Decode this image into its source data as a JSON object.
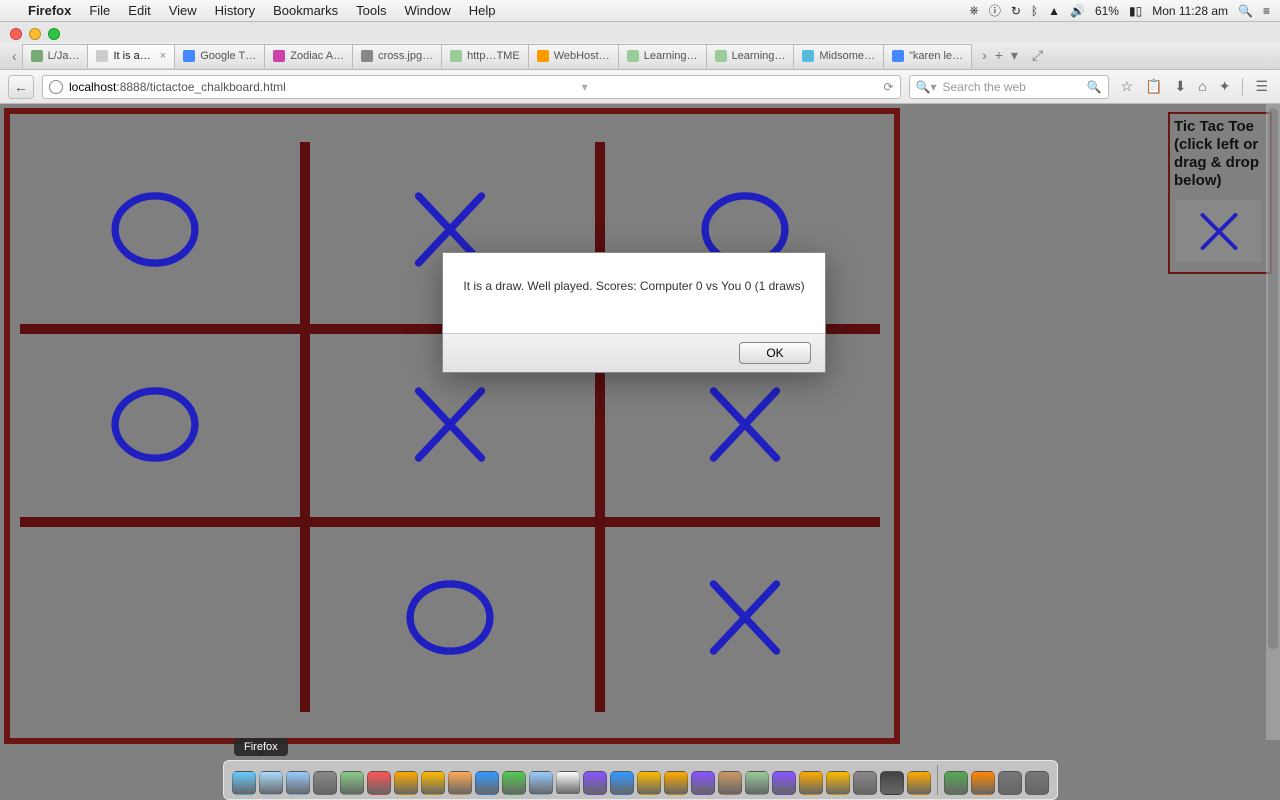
{
  "menubar": {
    "app": "Firefox",
    "items": [
      "File",
      "Edit",
      "View",
      "History",
      "Bookmarks",
      "Tools",
      "Window",
      "Help"
    ],
    "battery": "61%",
    "clock": "Mon 11:28 am"
  },
  "tabs": [
    {
      "label": "L/Ja…",
      "active": false
    },
    {
      "label": "It is a…",
      "active": true
    },
    {
      "label": "Google T…",
      "active": false
    },
    {
      "label": "Zodiac A…",
      "active": false
    },
    {
      "label": "cross.jpg…",
      "active": false
    },
    {
      "label": "http…TME",
      "active": false
    },
    {
      "label": "WebHost…",
      "active": false
    },
    {
      "label": "Learning…",
      "active": false
    },
    {
      "label": "Learning…",
      "active": false
    },
    {
      "label": "Midsome…",
      "active": false
    },
    {
      "label": "\"karen le…",
      "active": false
    }
  ],
  "url": {
    "host": "localhost",
    "port": ":8888",
    "path": "/tictactoe_chalkboard.html"
  },
  "search_placeholder": "Search the web",
  "sidebar": {
    "title": "Tic Tac Toe (click left or drag & drop below)"
  },
  "board": [
    [
      "O",
      "X",
      "O"
    ],
    [
      "O",
      "X",
      "X"
    ],
    [
      "",
      "O",
      "X"
    ]
  ],
  "dialog": {
    "message": "It is a draw. Well played. Scores: Computer 0 vs You 0 (1 draws)",
    "ok": "OK"
  },
  "dock_label": "Firefox"
}
